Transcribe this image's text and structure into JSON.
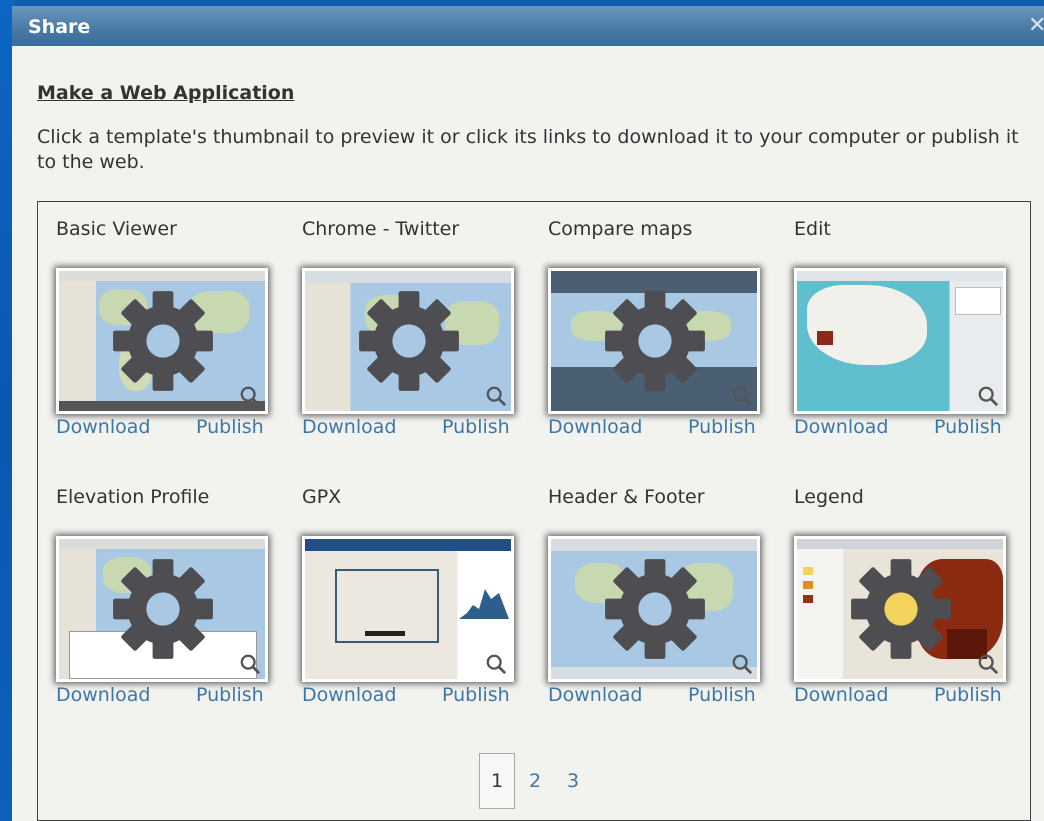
{
  "dialog": {
    "title": "Share",
    "heading": "Make a Web Application",
    "description": "Click a template's thumbnail to preview it or click its links to download it to your computer or publish it to the web."
  },
  "templates": [
    {
      "name": "Basic Viewer",
      "download": "Download",
      "publish": "Publish"
    },
    {
      "name": "Chrome - Twitter",
      "download": "Download",
      "publish": "Publish"
    },
    {
      "name": "Compare maps",
      "download": "Download",
      "publish": "Publish"
    },
    {
      "name": "Edit",
      "download": "Download",
      "publish": "Publish"
    },
    {
      "name": "Elevation Profile",
      "download": "Download",
      "publish": "Publish"
    },
    {
      "name": "GPX",
      "download": "Download",
      "publish": "Publish"
    },
    {
      "name": "Header & Footer",
      "download": "Download",
      "publish": "Publish"
    },
    {
      "name": "Legend",
      "download": "Download",
      "publish": "Publish"
    }
  ],
  "pagination": {
    "current": "1",
    "pages": [
      "2",
      "3"
    ]
  },
  "icons": {
    "close": "close-icon",
    "gear": "gear-icon",
    "zoom": "magnifier-icon"
  },
  "colors": {
    "link": "#3c77a8",
    "titlebar": "#4a7ba7",
    "gear": "#4e4e52"
  }
}
